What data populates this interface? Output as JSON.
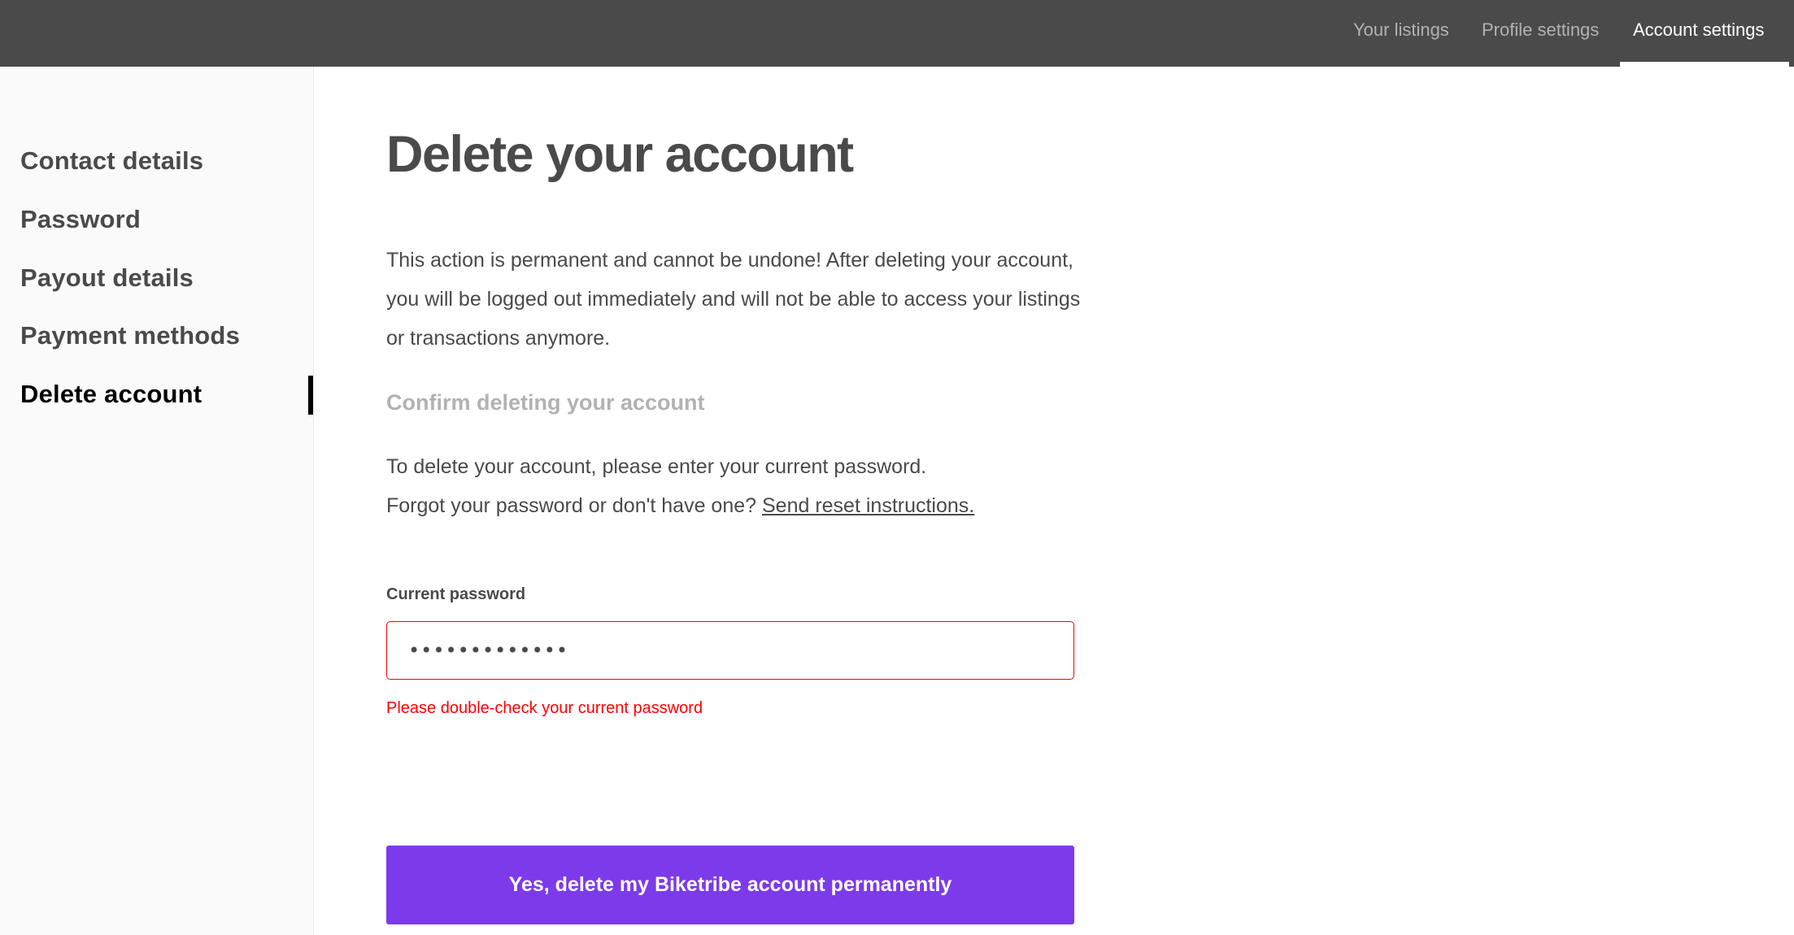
{
  "topbar": {
    "tabs": [
      {
        "label": "Your listings",
        "active": false
      },
      {
        "label": "Profile settings",
        "active": false
      },
      {
        "label": "Account settings",
        "active": true
      }
    ]
  },
  "sidebar": {
    "items": [
      {
        "label": "Contact details",
        "active": false
      },
      {
        "label": "Password",
        "active": false
      },
      {
        "label": "Payout details",
        "active": false
      },
      {
        "label": "Payment methods",
        "active": false
      },
      {
        "label": "Delete account",
        "active": true
      }
    ]
  },
  "main": {
    "title": "Delete your account",
    "intro": "This action is permanent and cannot be undone! After deleting your account, you will be logged out immediately and will not be able to access your listings or transactions anymore.",
    "confirm_heading": "Confirm deleting your account",
    "instruction_line1": "To delete your account, please enter your current password.",
    "instruction_line2": "Forgot your password or don't have one?",
    "reset_link": "Send reset instructions.",
    "password_label": "Current password",
    "password_value": "•••••••••••••",
    "error_message": "Please double-check your current password",
    "delete_button": "Yes, delete my Biketribe account permanently"
  },
  "colors": {
    "topbar_bg": "#4a4a4a",
    "accent": "#7c3aea",
    "error": "#ff0000",
    "text": "#4a4a4a",
    "muted": "#b2b2b2"
  }
}
